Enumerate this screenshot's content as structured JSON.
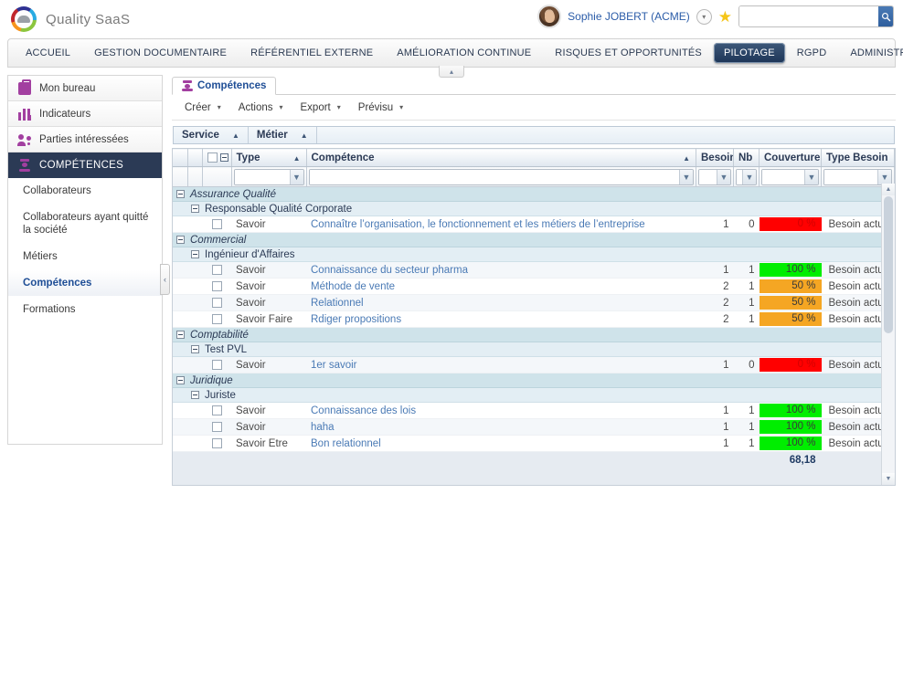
{
  "header": {
    "brand_name": "Quality SaaS",
    "user_name": "Sophie JOBERT (ACME)",
    "user_caret": "▾",
    "star_icon": "★",
    "search_value": "",
    "search_placeholder": "",
    "search_button_icon": "🔍"
  },
  "nav": {
    "items": [
      {
        "label": "ACCUEIL",
        "active": false
      },
      {
        "label": "GESTION DOCUMENTAIRE",
        "active": false
      },
      {
        "label": "RÉFÉRENTIEL EXTERNE",
        "active": false
      },
      {
        "label": "AMÉLIORATION CONTINUE",
        "active": false
      },
      {
        "label": "RISQUES ET OPPORTUNITÉS",
        "active": false
      },
      {
        "label": "PILOTAGE",
        "active": true
      },
      {
        "label": "RGPD",
        "active": false
      },
      {
        "label": "ADMINISTRATION",
        "active": false
      }
    ]
  },
  "sidebar": {
    "top_items": [
      {
        "label": "Mon bureau",
        "icon": "briefcase-icon",
        "selected": false
      },
      {
        "label": "Indicateurs",
        "icon": "bar-chart-icon",
        "selected": false
      },
      {
        "label": "Parties intéressées",
        "icon": "people-icon",
        "selected": false
      },
      {
        "label": "COMPÉTENCES",
        "icon": "competence-icon",
        "selected": true
      }
    ],
    "sub_items": [
      {
        "label": "Collaborateurs",
        "current": false
      },
      {
        "label": "Collaborateurs ayant quitté la société",
        "current": false
      },
      {
        "label": "Métiers",
        "current": false
      },
      {
        "label": "Compétences",
        "current": true
      },
      {
        "label": "Formations",
        "current": false
      }
    ],
    "collapse_icon": "‹"
  },
  "content": {
    "page_collapse_icon": "▴",
    "tab": {
      "label": "Compétences",
      "icon": "competence-icon"
    },
    "toolbar": [
      {
        "label": "Créer",
        "caret": "▾"
      },
      {
        "label": "Actions",
        "caret": "▾"
      },
      {
        "label": "Export",
        "caret": "▾"
      },
      {
        "label": "Prévisu",
        "caret": "▾"
      }
    ],
    "group_bar": [
      {
        "label": "Service",
        "sort": "▲"
      },
      {
        "label": "Métier",
        "sort": "▲"
      }
    ]
  },
  "grid": {
    "columns": [
      {
        "key": "expand",
        "label": "",
        "sort": ""
      },
      {
        "key": "spacer",
        "label": "",
        "sort": ""
      },
      {
        "key": "checkall",
        "label": "",
        "sort": ""
      },
      {
        "key": "type",
        "label": "Type",
        "sort": "▲"
      },
      {
        "key": "competence",
        "label": "Compétence",
        "sort": "▲"
      },
      {
        "key": "besoin",
        "label": "Besoin",
        "sort": ""
      },
      {
        "key": "nb",
        "label": "Nb",
        "sort": ""
      },
      {
        "key": "couverture",
        "label": "Couverture",
        "sort": ""
      },
      {
        "key": "type_besoin",
        "label": "Type Besoin",
        "sort": ""
      }
    ],
    "filters": {
      "type": "",
      "competence": "",
      "besoin": "",
      "nb": "",
      "couverture": "",
      "type_besoin": ""
    },
    "filter_icon": "▼",
    "rows": [
      {
        "kind": "group1",
        "label": "Assurance Qualité"
      },
      {
        "kind": "group2",
        "label": "Responsable Qualité Corporate"
      },
      {
        "kind": "data",
        "type": "Savoir",
        "competence": "Connaître l’organisation, le fonctionnement et les métiers de l’entreprise",
        "besoin": "1",
        "nb": "0",
        "couverture": "0 %",
        "couverture_color": "#ff0000",
        "couverture_text_color": "#d40000",
        "type_besoin": "Besoin actuel"
      },
      {
        "kind": "group1",
        "label": "Commercial"
      },
      {
        "kind": "group2",
        "label": "Ingénieur d'Affaires"
      },
      {
        "kind": "data",
        "type": "Savoir",
        "competence": "Connaissance du secteur pharma",
        "besoin": "1",
        "nb": "1",
        "couverture": "100 %",
        "couverture_color": "#00ee00",
        "couverture_text_color": "#3a3a3a",
        "type_besoin": "Besoin actuel"
      },
      {
        "kind": "data",
        "type": "Savoir",
        "competence": "Méthode de vente",
        "besoin": "2",
        "nb": "1",
        "couverture": "50 %",
        "couverture_color": "#f5a623",
        "couverture_text_color": "#3a3a3a",
        "type_besoin": "Besoin actuel"
      },
      {
        "kind": "data",
        "type": "Savoir",
        "competence": "Relationnel",
        "besoin": "2",
        "nb": "1",
        "couverture": "50 %",
        "couverture_color": "#f5a623",
        "couverture_text_color": "#3a3a3a",
        "type_besoin": "Besoin actuel"
      },
      {
        "kind": "data",
        "type": "Savoir Faire",
        "competence": "Rdiger propositions",
        "besoin": "2",
        "nb": "1",
        "couverture": "50 %",
        "couverture_color": "#f5a623",
        "couverture_text_color": "#3a3a3a",
        "type_besoin": "Besoin actuel"
      },
      {
        "kind": "group1",
        "label": "Comptabilité"
      },
      {
        "kind": "group2",
        "label": "Test PVL"
      },
      {
        "kind": "data",
        "type": "Savoir",
        "competence": "1er savoir",
        "besoin": "1",
        "nb": "0",
        "couverture": "0 %",
        "couverture_color": "#ff0000",
        "couverture_text_color": "#d40000",
        "type_besoin": "Besoin actuel"
      },
      {
        "kind": "group1",
        "label": "Juridique"
      },
      {
        "kind": "group2",
        "label": "Juriste"
      },
      {
        "kind": "data",
        "type": "Savoir",
        "competence": "Connaissance des lois",
        "besoin": "1",
        "nb": "1",
        "couverture": "100 %",
        "couverture_color": "#00ee00",
        "couverture_text_color": "#3a3a3a",
        "type_besoin": "Besoin actuel"
      },
      {
        "kind": "data",
        "type": "Savoir",
        "competence": "haha",
        "besoin": "1",
        "nb": "1",
        "couverture": "100 %",
        "couverture_color": "#00ee00",
        "couverture_text_color": "#3a3a3a",
        "type_besoin": "Besoin actuel"
      },
      {
        "kind": "data",
        "type": "Savoir Etre",
        "competence": "Bon relationnel",
        "besoin": "1",
        "nb": "1",
        "couverture": "100 %",
        "couverture_color": "#00ee00",
        "couverture_text_color": "#3a3a3a",
        "type_besoin": "Besoin actuel"
      }
    ],
    "total": "68,18",
    "scroll_up_icon": "▲",
    "scroll_down_icon": "▼"
  }
}
